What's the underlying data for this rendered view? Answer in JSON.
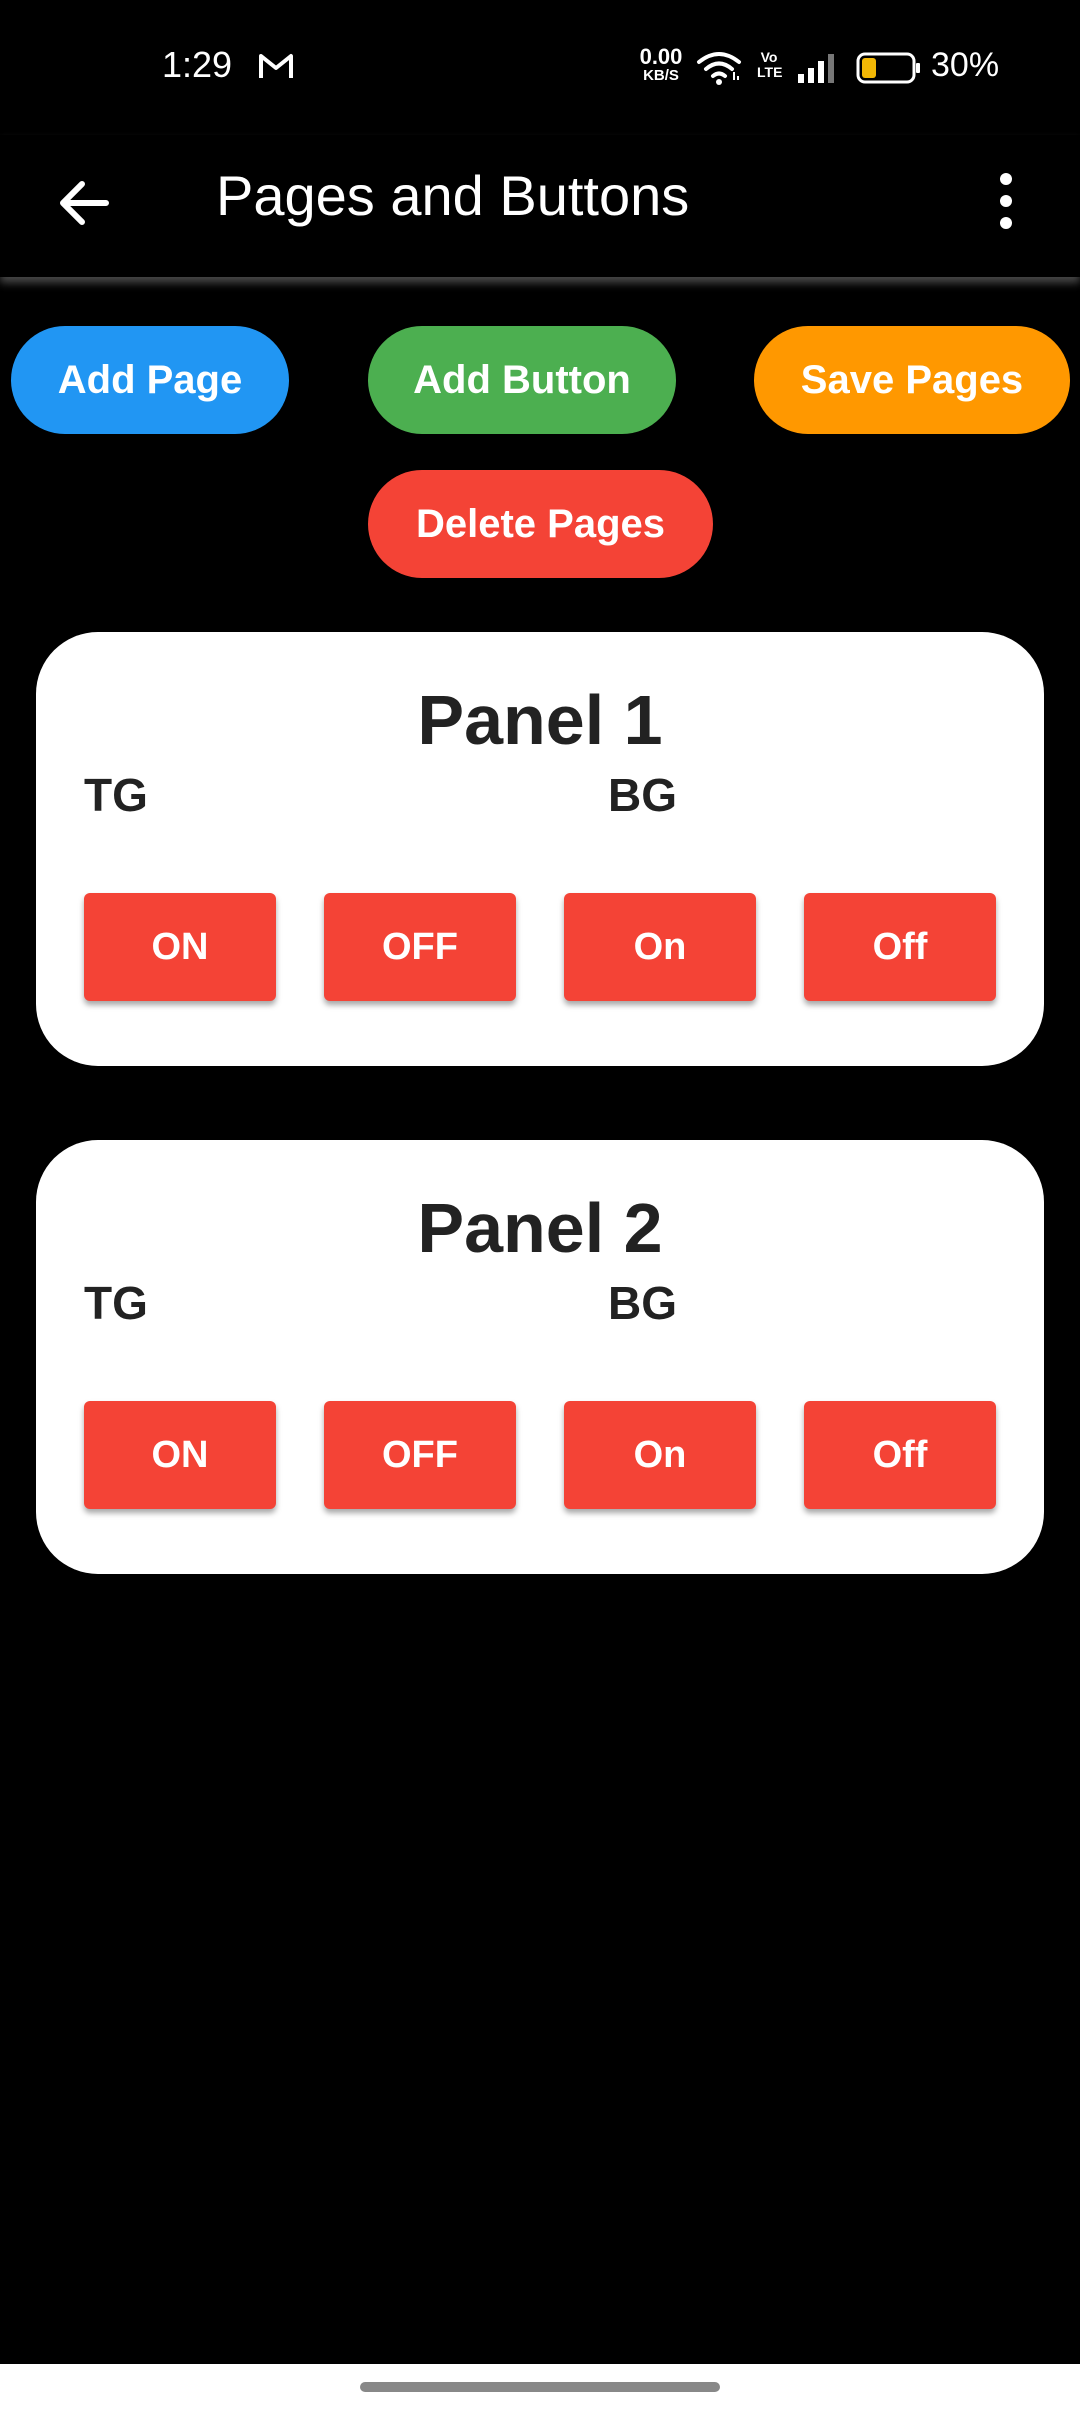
{
  "status_bar": {
    "time": "1:29",
    "net_speed_value": "0.00",
    "net_speed_unit": "KB/S",
    "volte_line1": "Vo",
    "volte_line2": "LTE",
    "battery_percent": "30%",
    "battery_level": 0.3,
    "icons": [
      "gmail-icon",
      "wifi-icon",
      "volte-icon",
      "signal-icon",
      "battery-icon"
    ]
  },
  "app_bar": {
    "title": "Pages and Buttons",
    "icons": [
      "back-arrow-icon",
      "more-vert-icon"
    ]
  },
  "actions": {
    "add_page": "Add Page",
    "add_button": "Add Button",
    "save_pages": "Save Pages",
    "delete_pages": "Delete Pages"
  },
  "panels": [
    {
      "title": "Panel 1",
      "group_labels": [
        "TG",
        "BG"
      ],
      "buttons": [
        "ON",
        "OFF",
        "On",
        "Off"
      ]
    },
    {
      "title": "Panel 2",
      "group_labels": [
        "TG",
        "BG"
      ],
      "buttons": [
        "ON",
        "OFF",
        "On",
        "Off"
      ]
    }
  ],
  "colors": {
    "add_page": "#2196F3",
    "add_button": "#4CAF50",
    "save_pages": "#FF9800",
    "delete_pages": "#F44336",
    "panel_button": "#F44336",
    "background": "#000000",
    "panel_bg": "#FFFFFF"
  }
}
